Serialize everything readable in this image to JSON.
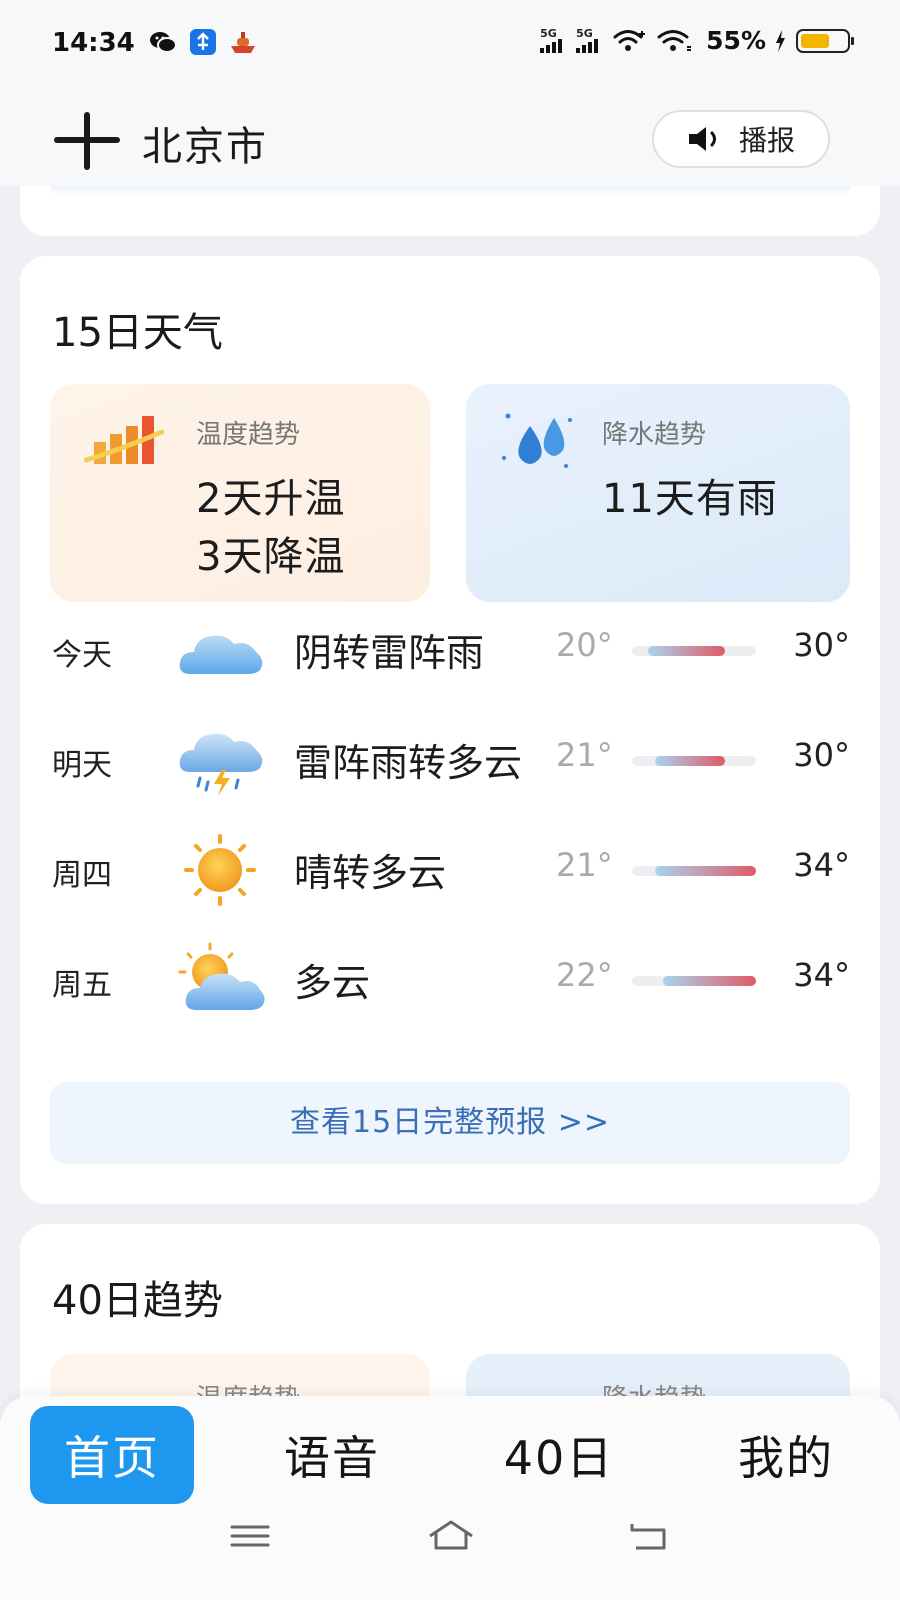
{
  "status_bar": {
    "time": "14:34",
    "network_1": "5G",
    "network_2": "5G",
    "battery_percent": "55%",
    "battery_level": 0.55,
    "icons": [
      "wechat-icon",
      "app-badge-icon",
      "boat-icon",
      "signal-icon",
      "wifi-icon",
      "battery-icon"
    ]
  },
  "header": {
    "city": "北京市",
    "broadcast_label": "播报"
  },
  "forecast_15": {
    "title": "15日天气",
    "temp_trend": {
      "label": "温度趋势",
      "line1": "2天升温",
      "line2": "3天降温"
    },
    "rain_trend": {
      "label": "降水趋势",
      "value": "11天有雨"
    },
    "days": [
      {
        "day": "今天",
        "desc": "阴转雷阵雨",
        "low": "20°",
        "high": "30°",
        "icon": "cloudy-icon"
      },
      {
        "day": "明天",
        "desc": "雷阵雨转多云",
        "low": "21°",
        "high": "30°",
        "icon": "thunderstorm-icon"
      },
      {
        "day": "周四",
        "desc": "晴转多云",
        "low": "21°",
        "high": "34°",
        "icon": "sunny-icon"
      },
      {
        "day": "周五",
        "desc": "多云",
        "low": "22°",
        "high": "34°",
        "icon": "partly-cloudy-icon"
      }
    ],
    "full_forecast_link": "查看15日完整预报 >>"
  },
  "trend_40": {
    "title": "40日趋势",
    "temp_label": "温度趋势",
    "rain_label": "降水趋势"
  },
  "bottom_nav": {
    "tabs": [
      "首页",
      "语音",
      "40日",
      "我的"
    ],
    "active": "首页"
  },
  "colors": {
    "accent": "#1e98ee",
    "link": "#3a6fb6",
    "temp_bar_cold": "#a8d4f0",
    "temp_bar_hot": "#e05a66"
  }
}
